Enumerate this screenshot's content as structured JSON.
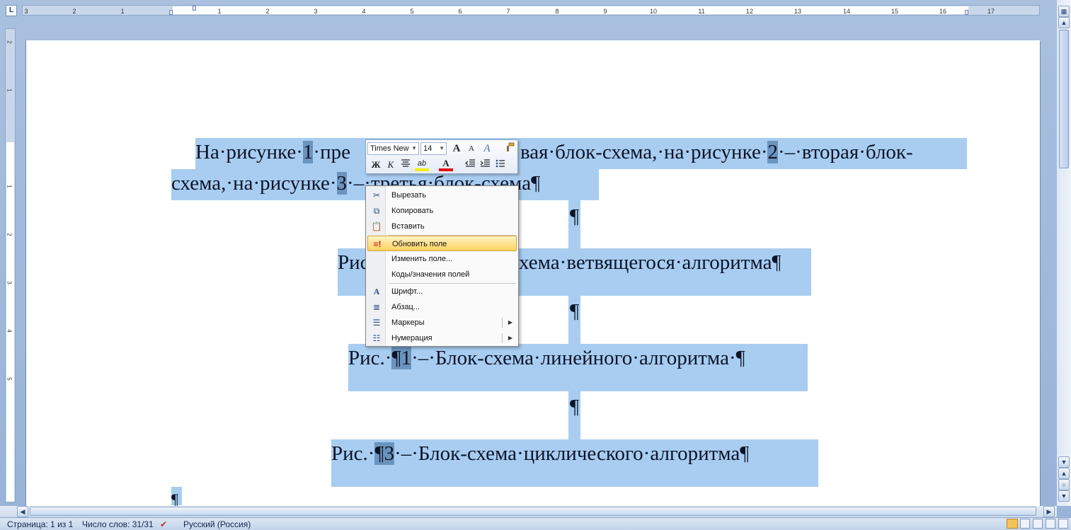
{
  "ruler": {
    "tab_marker": "L",
    "ticks": [
      "3",
      "2",
      "1",
      "1",
      "2",
      "3",
      "4",
      "5",
      "6",
      "7",
      "8",
      "9",
      "10",
      "11",
      "12",
      "13",
      "14",
      "15",
      "16",
      "17"
    ],
    "vticks": [
      "2",
      "1",
      "1",
      "2",
      "3",
      "4",
      "5"
    ]
  },
  "document": {
    "line1_pre": "На·рисунке·",
    "line1_n1": "1",
    "line1_mid": "·пре",
    "line1_post": "вая·блок-схема,·на·рисунке·",
    "line1_n2": "2",
    "line1_end": "·–·вторая·блок-",
    "line2_pre": "схема,·на·рисунке·",
    "line2_n3": "3",
    "line2_end": "·–·третья·блок-схема¶",
    "empty1": "¶",
    "fig2_pre": "Рис",
    "fig2_post": "хема·ветвящегося·алгоритма¶",
    "empty2": "¶",
    "fig1_pre": "Рис.·",
    "fig1_mark": "¶",
    "fig1_num": "1",
    "fig1_post": "·–·Блок-схема·линейного·алгоритма·¶",
    "empty3": "¶",
    "fig3_pre": "Рис.·",
    "fig3_mark": "¶",
    "fig3_num": "3",
    "fig3_post": "·–·Блок-схема·циклического·алгоритма¶",
    "last_mark": "¶"
  },
  "mini_toolbar": {
    "font_name": "Times New",
    "font_size": "14",
    "grow_font": "A",
    "shrink_font": "A",
    "styles": "A",
    "bold": "Ж",
    "italic": "К",
    "highlight": "ab",
    "font_color": "A"
  },
  "context_menu": {
    "items": [
      {
        "label": "Вырезать",
        "icon": "scissors-icon"
      },
      {
        "label": "Копировать",
        "icon": "copy-icon"
      },
      {
        "label": "Вставить",
        "icon": "paste-icon"
      },
      {
        "label": "Обновить поле",
        "icon": "update-field-icon",
        "highlighted": true
      },
      {
        "label": "Изменить поле...",
        "icon": ""
      },
      {
        "label": "Коды/значения полей",
        "icon": ""
      },
      {
        "label": "Шрифт...",
        "icon": "font-icon"
      },
      {
        "label": "Абзац...",
        "icon": "paragraph-icon"
      },
      {
        "label": "Маркеры",
        "icon": "bullets-icon",
        "submenu": true
      },
      {
        "label": "Нумерация",
        "icon": "numbering-icon",
        "submenu": true
      }
    ]
  },
  "status_bar": {
    "page": "Страница: 1 из 1",
    "words": "Число слов: 31/31",
    "language": "Русский (Россия)"
  },
  "colors": {
    "selection": "#a8cdf1",
    "field_shading": "#6b94bd",
    "menu_highlight": "#ffd25e"
  }
}
